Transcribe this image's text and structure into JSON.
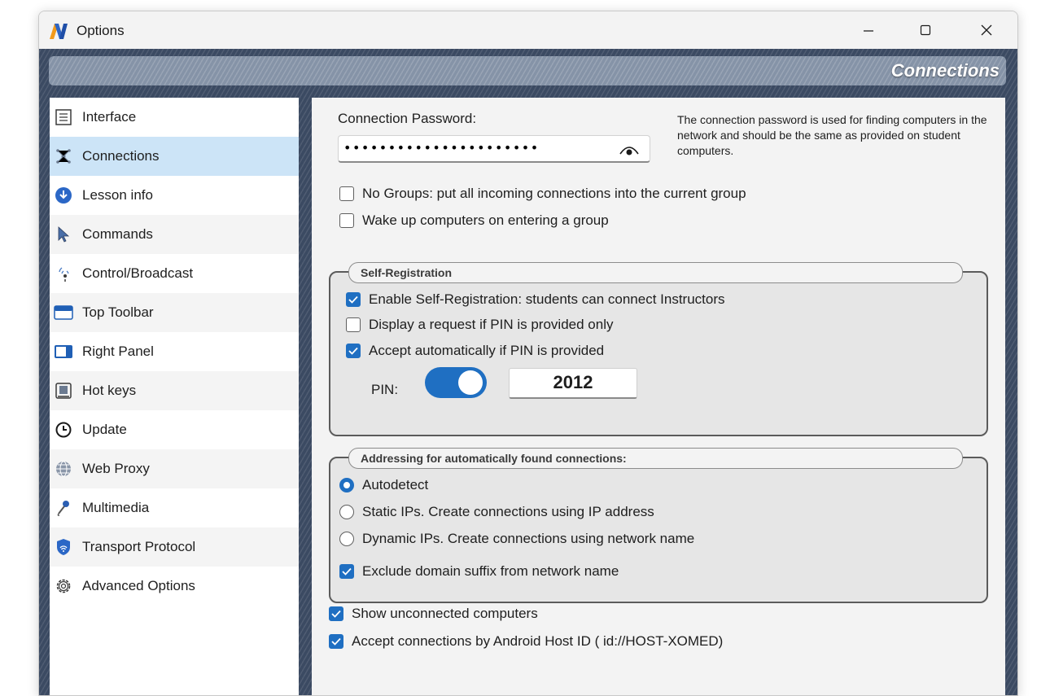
{
  "window": {
    "title": "Options"
  },
  "header": {
    "title": "Connections"
  },
  "sidebar": {
    "items": [
      {
        "label": "Interface",
        "icon": "interface-icon"
      },
      {
        "label": "Connections",
        "icon": "network-icon",
        "active": true
      },
      {
        "label": "Lesson info",
        "icon": "download-icon"
      },
      {
        "label": "Commands",
        "icon": "cursor-icon"
      },
      {
        "label": "Control/Broadcast",
        "icon": "broadcast-icon"
      },
      {
        "label": "Top Toolbar",
        "icon": "top-toolbar-icon"
      },
      {
        "label": "Right Panel",
        "icon": "right-panel-icon"
      },
      {
        "label": "Hot keys",
        "icon": "keyboard-icon"
      },
      {
        "label": "Update",
        "icon": "clock-icon"
      },
      {
        "label": "Web Proxy",
        "icon": "globe-icon"
      },
      {
        "label": "Multimedia",
        "icon": "microphone-icon"
      },
      {
        "label": "Transport Protocol",
        "icon": "shield-icon"
      },
      {
        "label": "Advanced Options",
        "icon": "gear-icon"
      }
    ]
  },
  "main": {
    "password_label": "Connection Password:",
    "password_value": "••••••••••••••••••••••",
    "password_help": "The connection password is used for finding computers in the network and should be the same as provided on student computers.",
    "no_groups": {
      "label": "No Groups: put all incoming connections into the current group",
      "checked": false
    },
    "wake_up": {
      "label": "Wake up computers on entering a group",
      "checked": false
    },
    "self_registration": {
      "title": "Self-Registration",
      "enable": {
        "label": "Enable Self-Registration: students can connect Instructors",
        "checked": true
      },
      "display_request": {
        "label": "Display a request if PIN is provided only",
        "checked": false
      },
      "accept_auto": {
        "label": "Accept automatically if PIN is provided",
        "checked": true
      },
      "pin_label": "PIN:",
      "pin_toggle_on": true,
      "pin_value": "2012"
    },
    "addressing": {
      "title": "Addressing for automatically found connections:",
      "options": [
        {
          "label": "Autodetect",
          "selected": true
        },
        {
          "label": "Static IPs. Create connections using IP address",
          "selected": false
        },
        {
          "label": "Dynamic IPs. Create connections using network name",
          "selected": false
        }
      ],
      "exclude_suffix": {
        "label": "Exclude domain suffix from network name",
        "checked": true
      }
    },
    "show_unconnected": {
      "label": "Show unconnected computers",
      "checked": true
    },
    "accept_android": {
      "label": "Accept connections by Android Host ID  ( id://HOST-XOMED)",
      "checked": true
    }
  },
  "colors": {
    "accent": "#1f6fc2",
    "active_item": "#cce4f7",
    "frame": "#3b4a62"
  }
}
